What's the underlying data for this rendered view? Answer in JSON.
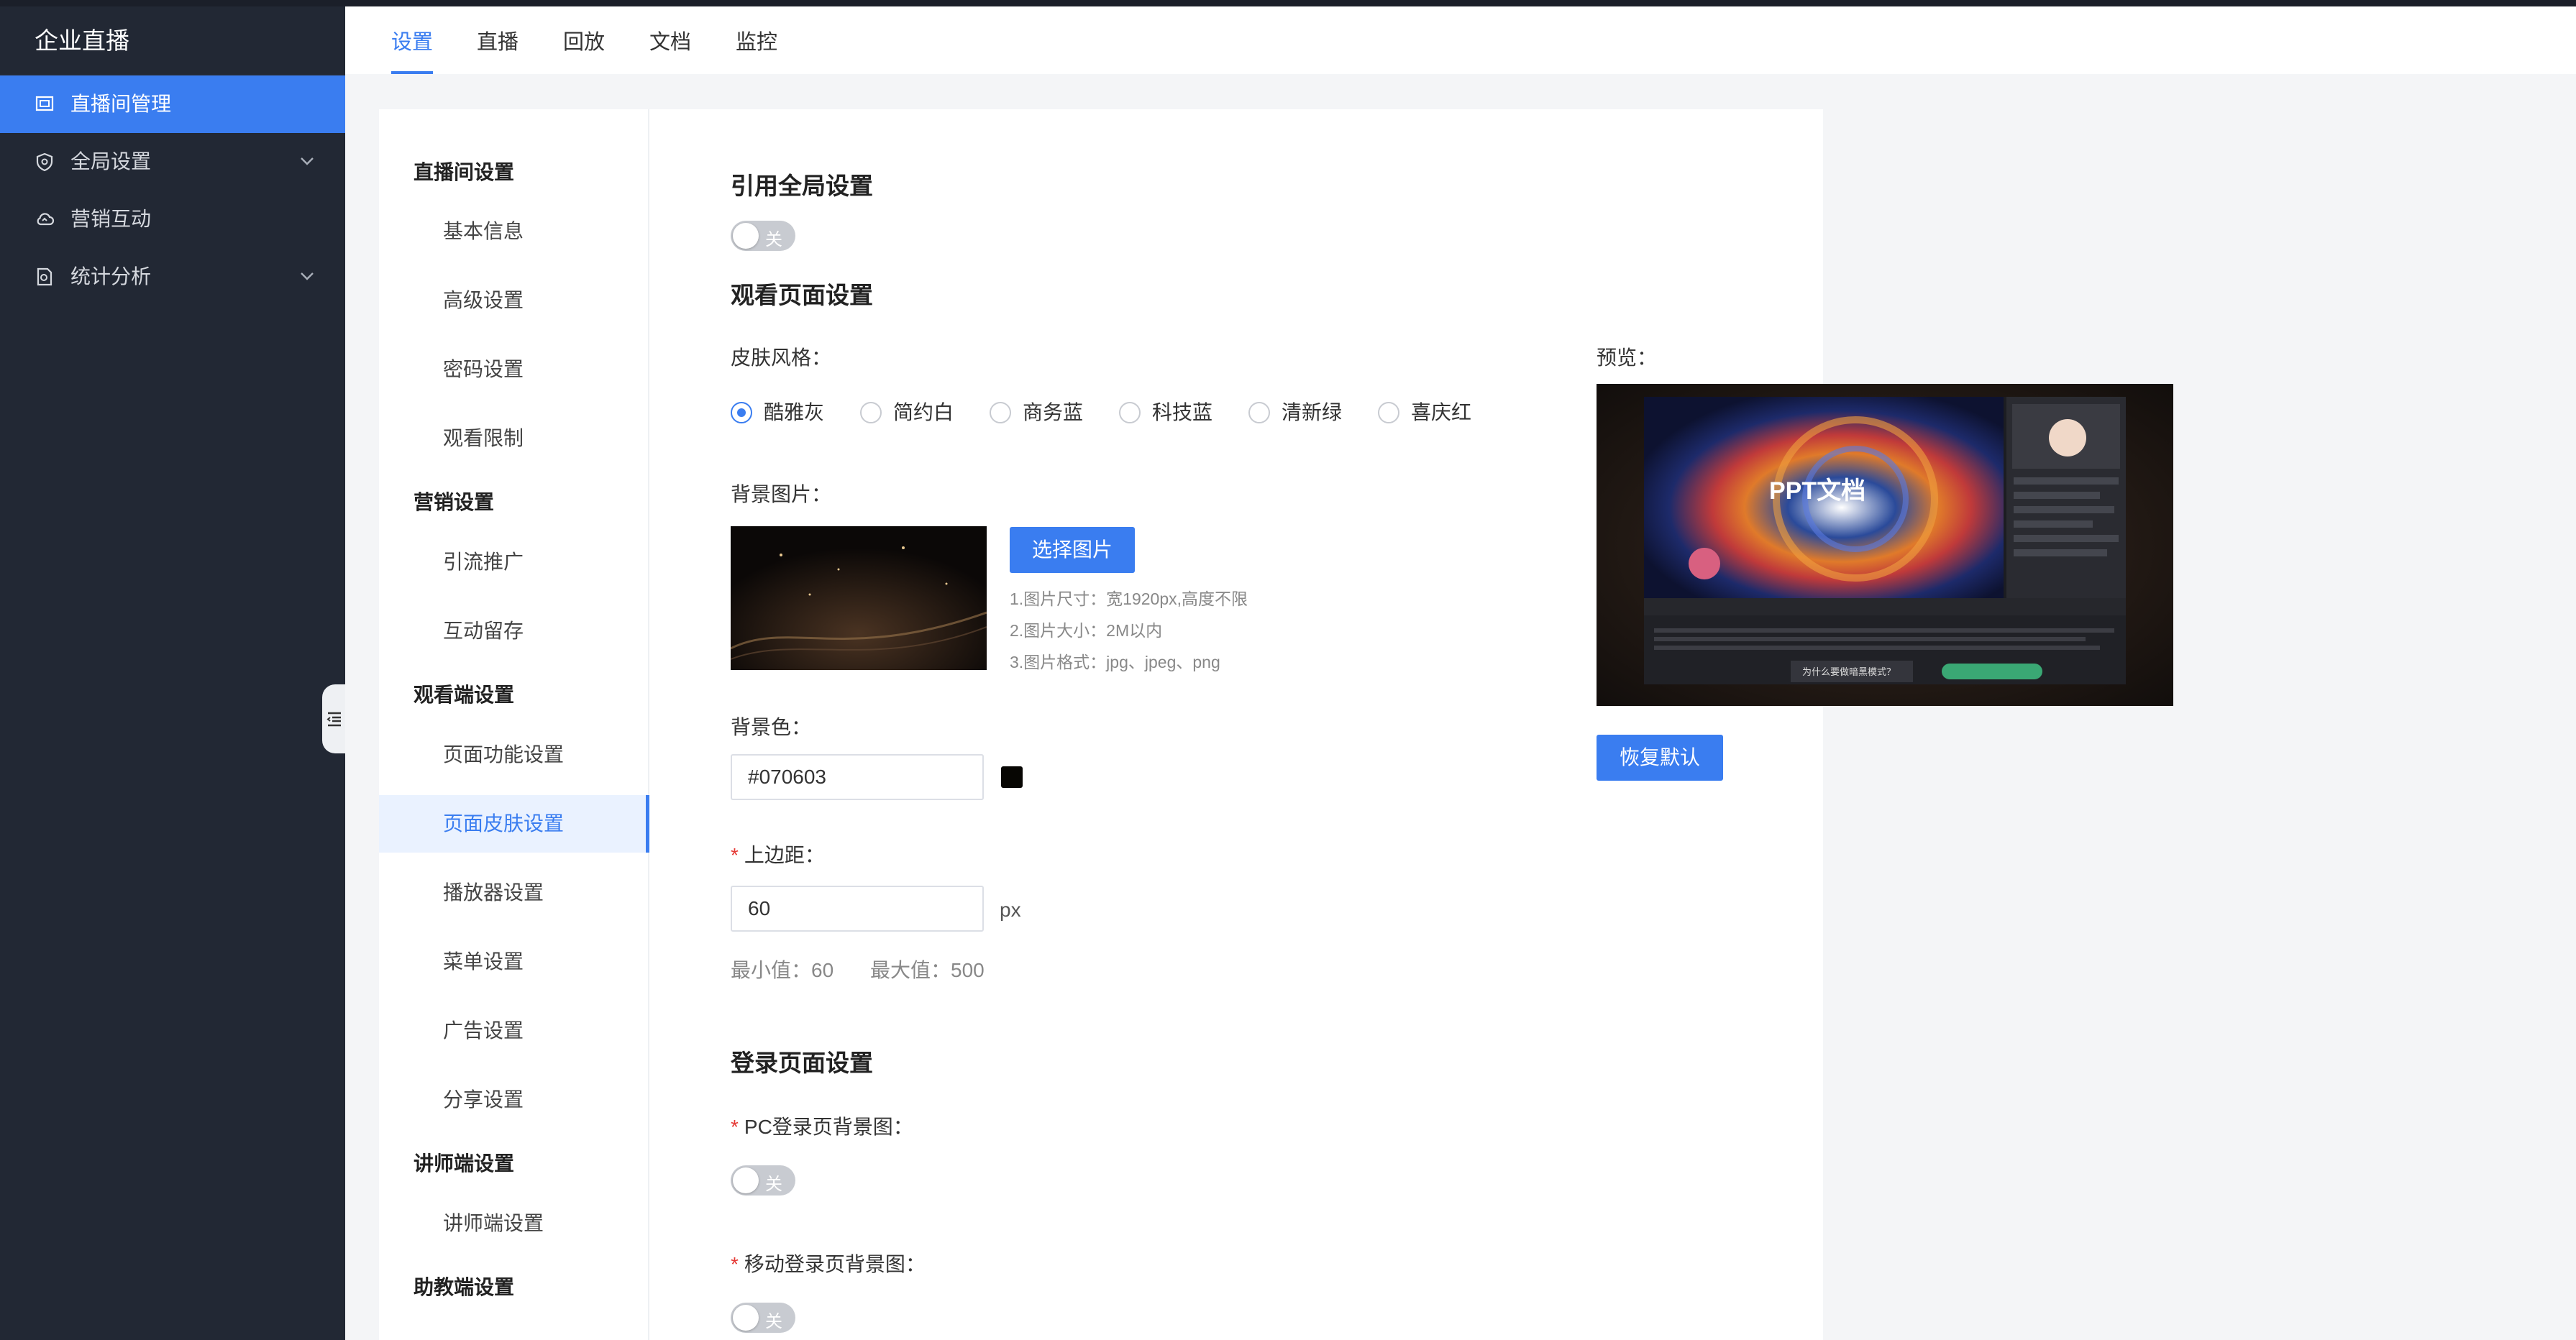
{
  "sidebar": {
    "title": "企业直播",
    "items": [
      {
        "label": "直播间管理",
        "icon": "monitor-icon",
        "active": true
      },
      {
        "label": "全局设置",
        "icon": "shield-icon",
        "has_children": true
      },
      {
        "label": "营销互动",
        "icon": "cloud-icon"
      },
      {
        "label": "统计分析",
        "icon": "report-icon",
        "has_children": true
      }
    ]
  },
  "tabs": [
    "设置",
    "直播",
    "回放",
    "文档",
    "监控"
  ],
  "active_tab": "设置",
  "subnav": {
    "groups": [
      {
        "title": "直播间设置",
        "items": [
          "基本信息",
          "高级设置",
          "密码设置",
          "观看限制"
        ]
      },
      {
        "title": "营销设置",
        "items": [
          "引流推广",
          "互动留存"
        ]
      },
      {
        "title": "观看端设置",
        "items": [
          "页面功能设置",
          "页面皮肤设置",
          "播放器设置",
          "菜单设置",
          "广告设置",
          "分享设置"
        ]
      },
      {
        "title": "讲师端设置",
        "items": [
          "讲师端设置"
        ]
      },
      {
        "title": "助教端设置",
        "items": []
      }
    ],
    "active_item": "页面皮肤设置"
  },
  "form": {
    "global_section_title": "引用全局设置",
    "global_toggle": {
      "text": "关",
      "on": false
    },
    "watch_section_title": "观看页面设置",
    "skin_label": "皮肤风格：",
    "skins": [
      "酷雅灰",
      "简约白",
      "商务蓝",
      "科技蓝",
      "清新绿",
      "喜庆红"
    ],
    "selected_skin": "酷雅灰",
    "bg_image_label": "背景图片：",
    "choose_image_button": "选择图片",
    "image_hints": [
      "1.图片尺寸：宽1920px,高度不限",
      "2.图片大小：2M以内",
      "3.图片格式：jpg、jpeg、png"
    ],
    "bg_color_label": "背景色：",
    "bg_color_value": "#070603",
    "top_margin_label": "上边距：",
    "top_margin_value": "60",
    "top_margin_unit": "px",
    "min_text": "最小值：60",
    "max_text": "最大值：500",
    "login_section_title": "登录页面设置",
    "pc_login_label": "PC登录页背景图：",
    "pc_login_toggle": {
      "text": "关",
      "on": false
    },
    "mobile_login_label": "移动登录页背景图：",
    "mobile_login_toggle": {
      "text": "关",
      "on": false
    }
  },
  "preview": {
    "label": "预览：",
    "ppt_title": "PPT文档",
    "prompt_text": "为什么要做暗黑模式？",
    "restore_button": "恢复默认"
  },
  "colors": {
    "accent": "#3a7df0",
    "sidebar_bg": "#222834",
    "swatch": "#070603",
    "required": "#e53935"
  }
}
